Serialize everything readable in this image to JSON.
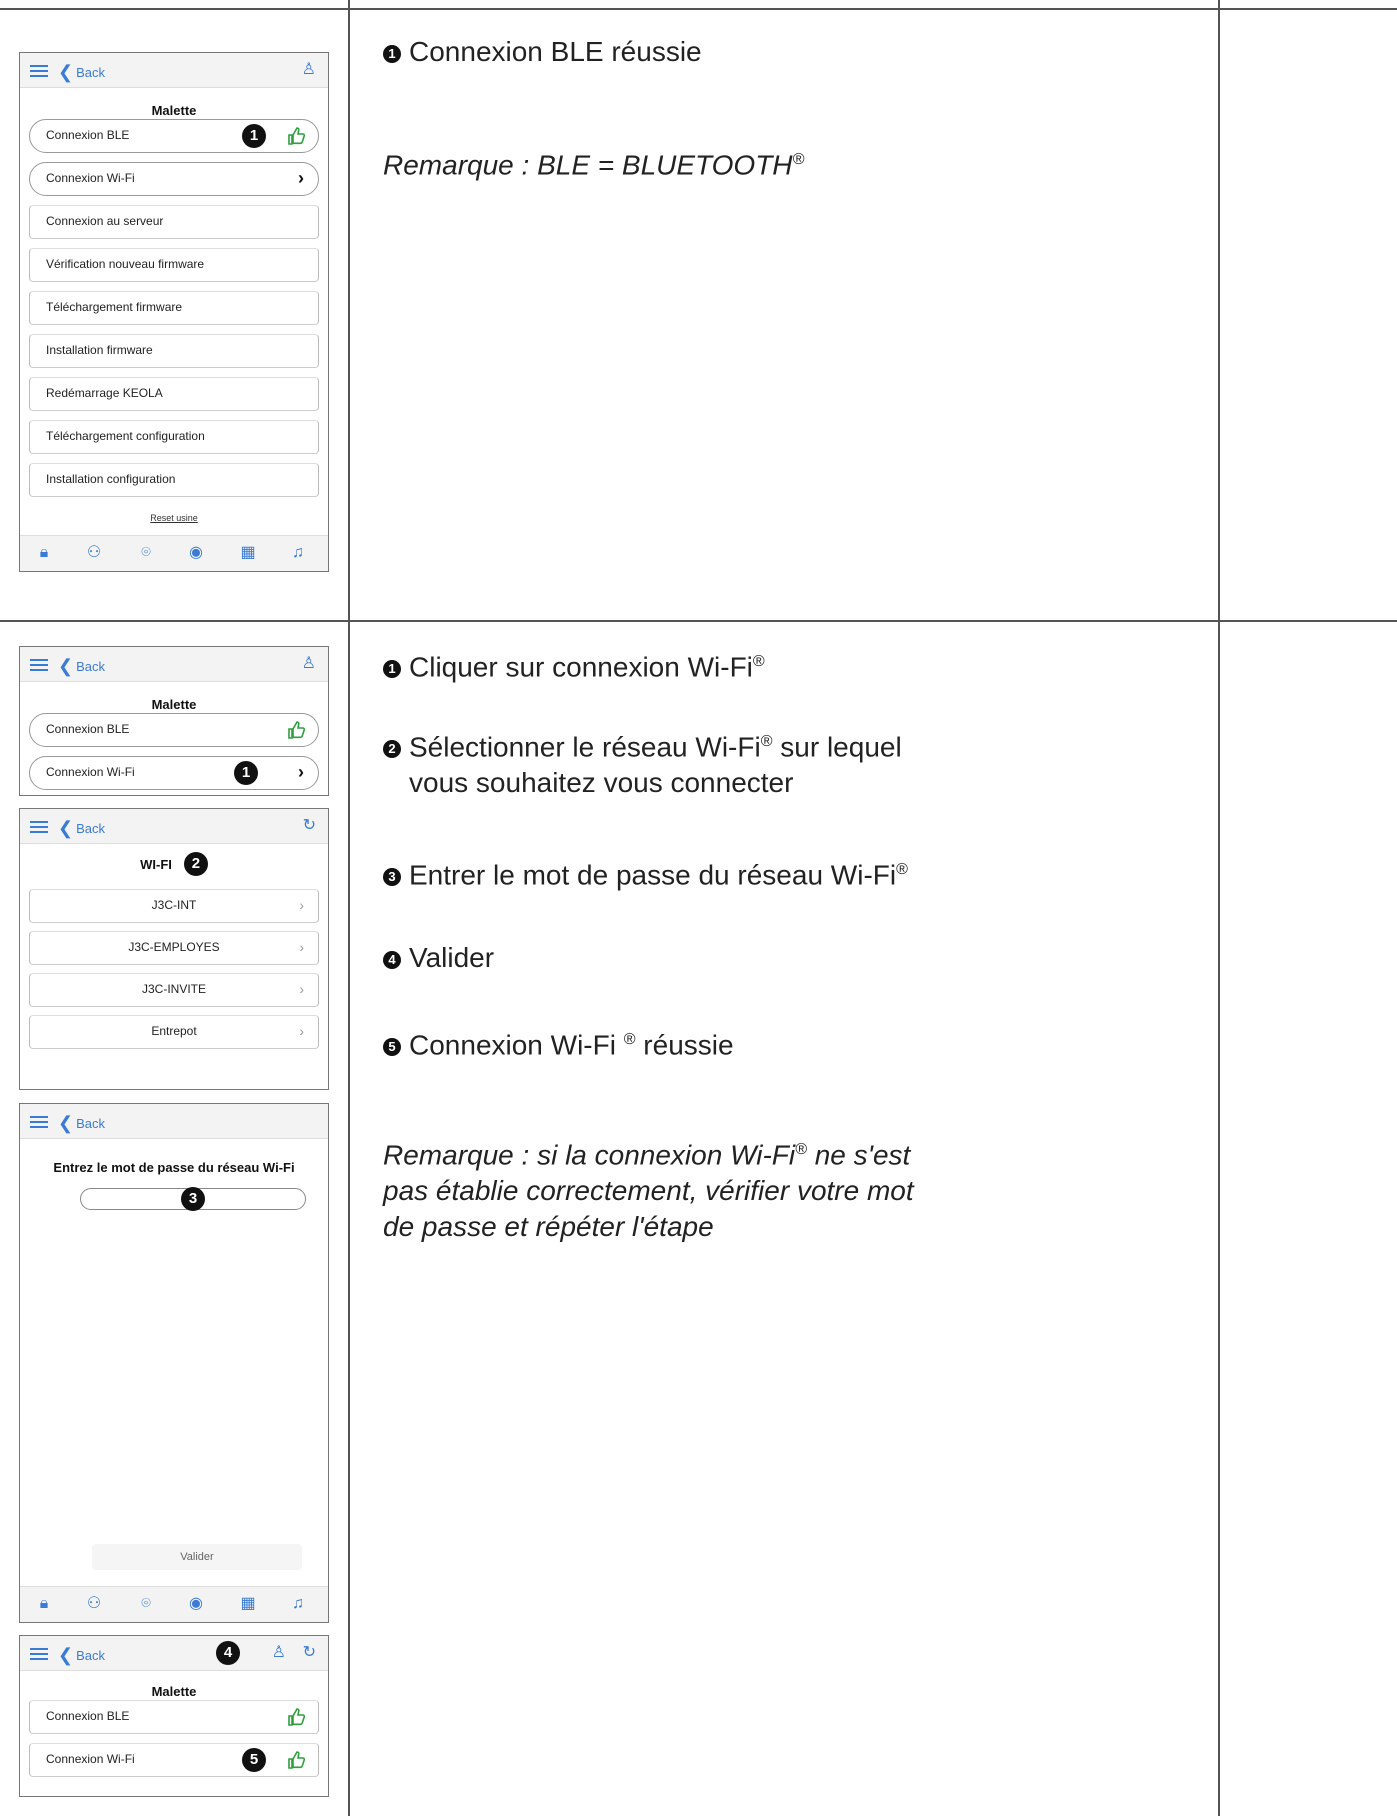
{
  "row1": {
    "screen": {
      "back_label": "Back",
      "title": "Malette",
      "items": [
        {
          "label": "Connexion BLE"
        },
        {
          "label": "Connexion Wi-Fi"
        },
        {
          "label": "Connexion au serveur"
        },
        {
          "label": "Vérification nouveau firmware"
        },
        {
          "label": "Téléchargement firmware"
        },
        {
          "label": "Installation firmware"
        },
        {
          "label": "Redémarrage KEOLA"
        },
        {
          "label": "Téléchargement configuration"
        },
        {
          "label": "Installation configuration"
        }
      ],
      "reset_link": "Reset usine",
      "badge": "1",
      "tabs": [
        "lock-icon",
        "users-icon",
        "location-icon",
        "account-icon",
        "calendar-icon",
        "bell-icon"
      ]
    },
    "instructions": {
      "step1_num": "1",
      "step1": "Connexion BLE réussie",
      "remark": "Remarque : BLE = BLUETOOTH",
      "remark_sup": "®"
    }
  },
  "row2": {
    "screen_a": {
      "back_label": "Back",
      "title": "Malette",
      "items": [
        {
          "label": "Connexion BLE"
        },
        {
          "label": "Connexion Wi-Fi"
        }
      ],
      "badge": "1"
    },
    "screen_b": {
      "back_label": "Back",
      "title": "WI-FI",
      "badge": "2",
      "networks": [
        {
          "label": "J3C-INT"
        },
        {
          "label": "J3C-EMPLOYES"
        },
        {
          "label": "J3C-INVITE"
        },
        {
          "label": "Entrepot"
        }
      ]
    },
    "screen_c": {
      "back_label": "Back",
      "title": "Entrez le mot de passe du réseau Wi-Fi",
      "badge": "3",
      "validate_label": "Valider"
    },
    "screen_d": {
      "back_label": "Back",
      "title": "Malette",
      "badge4": "4",
      "badge5": "5",
      "items": [
        {
          "label": "Connexion BLE"
        },
        {
          "label": "Connexion Wi-Fi"
        }
      ]
    },
    "instructions": {
      "s1n": "1",
      "s1": "Cliquer sur connexion Wi-Fi",
      "s2n": "2",
      "s2a": "Sélectionner le réseau Wi-Fi",
      "s2b": " sur lequel",
      "s2c": "vous souhaitez vous connecter",
      "s3n": "3",
      "s3": "Entrer le mot de passe du réseau Wi-Fi",
      "s4n": "4",
      "s4": "Valider",
      "s5n": "5",
      "s5a": "Connexion Wi-Fi ",
      "s5b": " réussie",
      "sup": "®",
      "remark_a": "Remarque : si la connexion Wi-Fi",
      "remark_b": " ne s'est",
      "remark_c": "pas établie correctement, vérifier votre mot",
      "remark_d": "de passe et répéter l'étape"
    }
  },
  "colors": {
    "accent": "#3a7bd5",
    "success": "#2e9e3f"
  }
}
